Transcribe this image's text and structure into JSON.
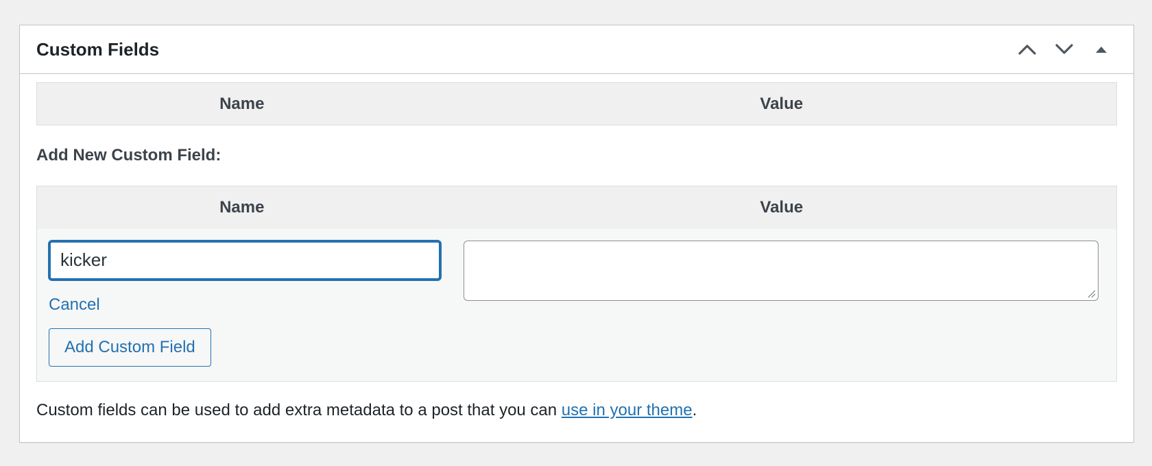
{
  "metabox": {
    "title": "Custom Fields",
    "icons": {
      "move_up": "chevron-up-icon",
      "move_down": "chevron-down-icon",
      "toggle": "triangle-up-icon"
    }
  },
  "existing_table": {
    "columns": [
      "Name",
      "Value"
    ]
  },
  "add_new": {
    "heading": "Add New Custom Field:",
    "columns": [
      "Name",
      "Value"
    ],
    "name_value": "kicker",
    "value_value": "",
    "cancel_label": "Cancel",
    "add_button_label": "Add Custom Field"
  },
  "footer": {
    "text_before": "Custom fields can be used to add extra metadata to a post that you can ",
    "link_text": "use in your theme",
    "text_after": "."
  },
  "colors": {
    "accent": "#2271b1",
    "page_bg": "#f0f0f1",
    "border": "#c3c4c7"
  }
}
